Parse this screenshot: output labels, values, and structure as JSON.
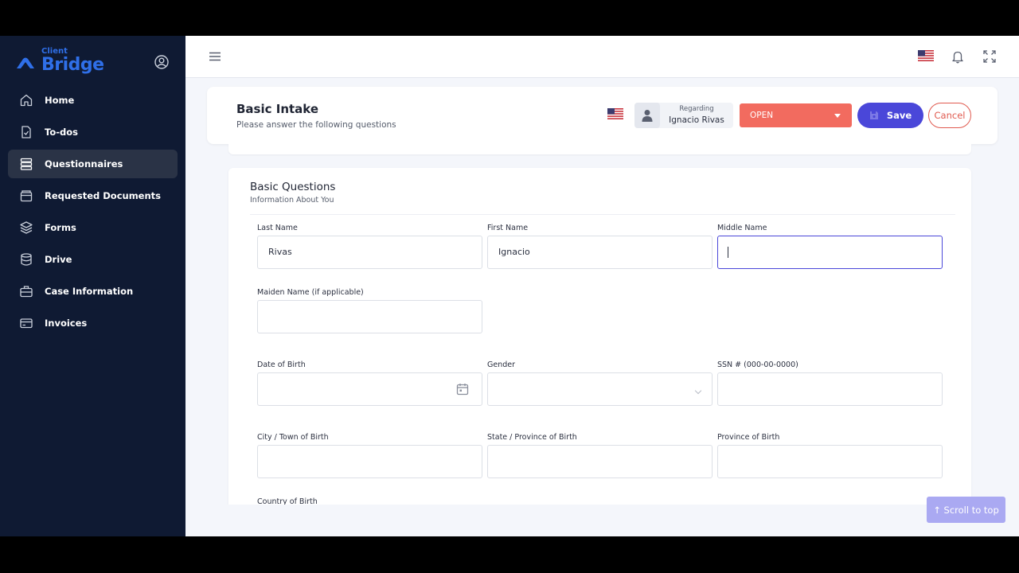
{
  "app": {
    "logo_small": "Client",
    "logo_big": "Bridge"
  },
  "sidebar": {
    "items": [
      {
        "label": "Home",
        "icon": "home-icon"
      },
      {
        "label": "To-dos",
        "icon": "todo-icon"
      },
      {
        "label": "Questionnaires",
        "icon": "questionnaire-icon"
      },
      {
        "label": "Requested Documents",
        "icon": "documents-icon"
      },
      {
        "label": "Forms",
        "icon": "forms-icon"
      },
      {
        "label": "Drive",
        "icon": "drive-icon"
      },
      {
        "label": "Case Information",
        "icon": "briefcase-icon"
      },
      {
        "label": "Invoices",
        "icon": "invoice-icon"
      }
    ],
    "active_index": 2
  },
  "header": {
    "title": "Basic Intake",
    "subtitle": "Please answer the following questions",
    "regarding_label": "Regarding",
    "regarding_name": "Ignacio Rivas",
    "status": "OPEN",
    "save_label": "Save",
    "cancel_label": "Cancel"
  },
  "form": {
    "title": "Basic Questions",
    "subtitle": "Information About You",
    "fields": {
      "last_name": {
        "label": "Last Name",
        "value": "Rivas"
      },
      "first_name": {
        "label": "First Name",
        "value": "Ignacio"
      },
      "middle_name": {
        "label": "Middle Name",
        "value": ""
      },
      "maiden_name": {
        "label": "Maiden Name (if applicable)",
        "value": ""
      },
      "dob": {
        "label": "Date of Birth",
        "value": ""
      },
      "gender": {
        "label": "Gender",
        "value": ""
      },
      "ssn": {
        "label": "SSN # (000-00-0000)",
        "value": ""
      },
      "city_birth": {
        "label": "City / Town of Birth",
        "value": ""
      },
      "state_birth": {
        "label": "State / Province of Birth",
        "value": ""
      },
      "province_birth": {
        "label": "Province of Birth",
        "value": ""
      },
      "country_birth": {
        "label": "Country of Birth",
        "value": ""
      }
    }
  },
  "scroll_top_label": "↑ Scroll to top",
  "colors": {
    "sidebar_bg": "#0f1a33",
    "accent": "#4a47d9",
    "status_open": "#f26b5f",
    "brand": "#2f6fe8"
  }
}
